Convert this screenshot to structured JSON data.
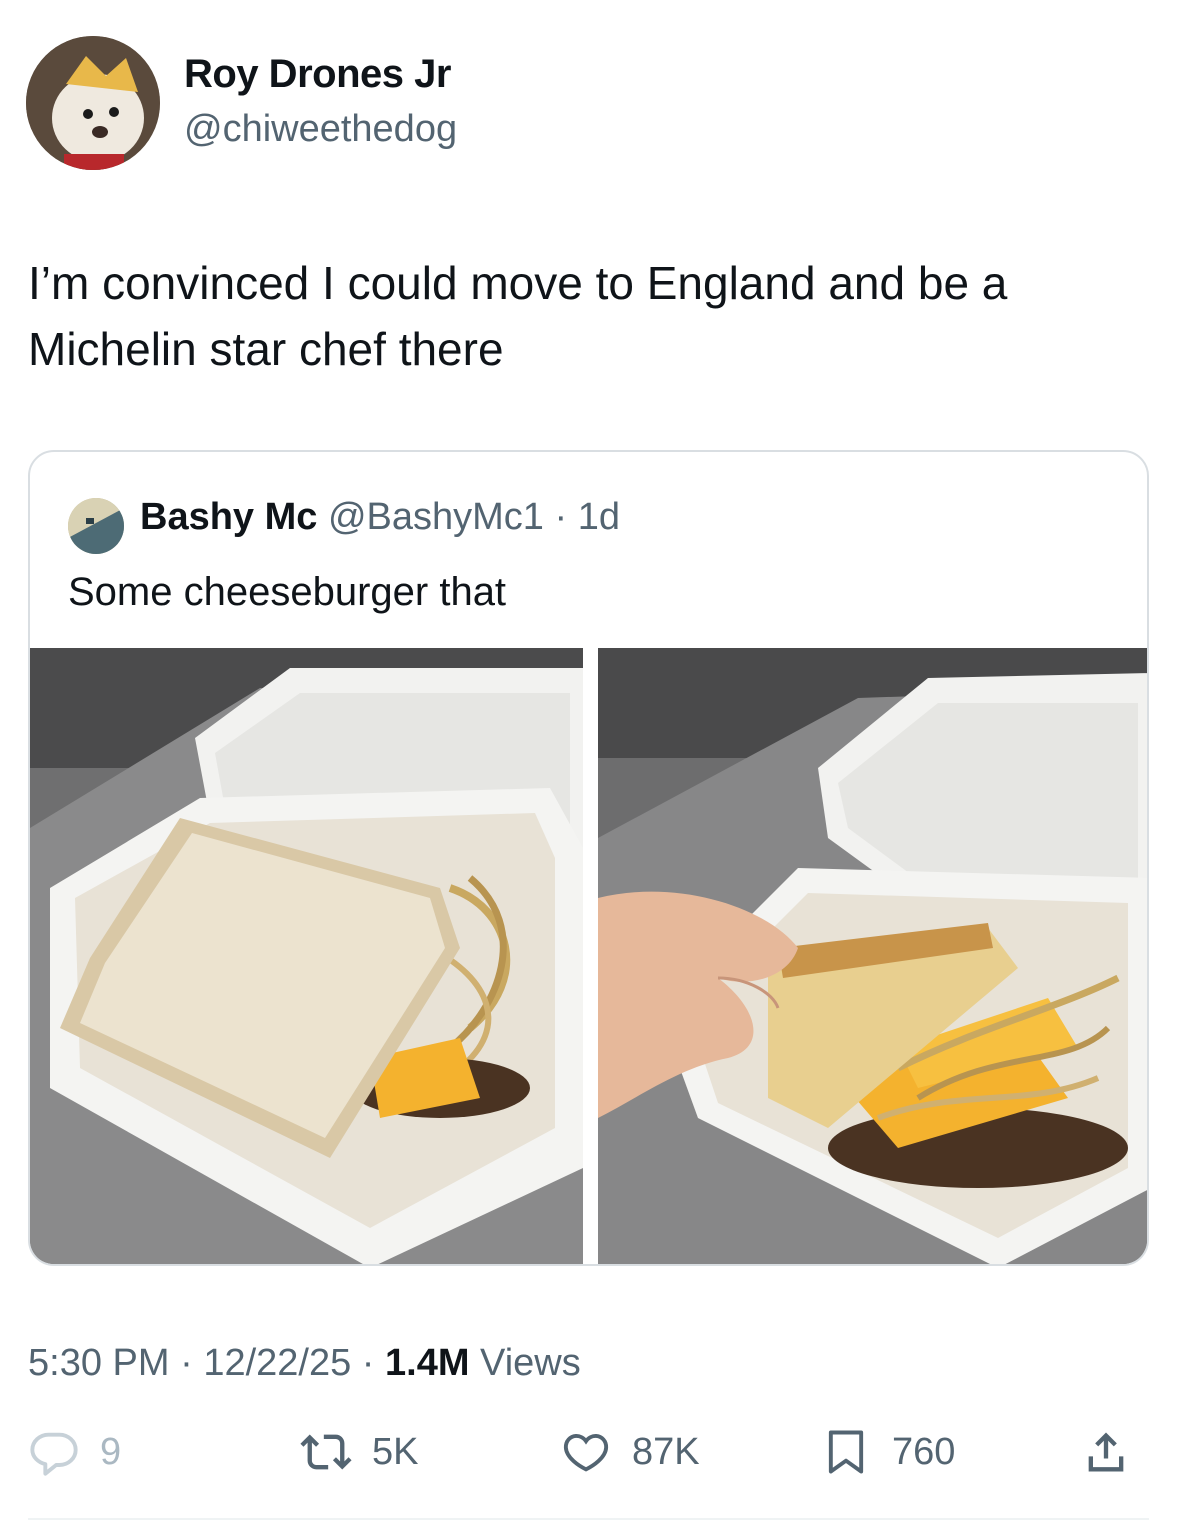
{
  "author": {
    "display_name": "Roy Drones Jr",
    "handle": "@chiweethedog"
  },
  "tweet": {
    "text": "I’m convinced I could move to England and be a\nMichelin star chef there"
  },
  "quoted": {
    "display_name": "Bashy Mc",
    "handle": "@BashyMc1",
    "separator": " · ",
    "age": "1d",
    "text": "Some cheeseburger that"
  },
  "meta": {
    "time": "5:30 PM",
    "separator": " · ",
    "date": "12/22/25",
    "views_count": "1.4M",
    "views_label": " Views"
  },
  "actions": {
    "reply_count": "9",
    "repost_count": "5K",
    "like_count": "87K",
    "bookmark_count": "760"
  },
  "icons": {
    "reply": "reply-icon",
    "repost": "repost-icon",
    "like": "heart-icon",
    "bookmark": "bookmark-icon",
    "share": "share-icon"
  },
  "colors": {
    "text": "#0f1419",
    "secondary": "#536471",
    "border": "#d9dee2"
  }
}
